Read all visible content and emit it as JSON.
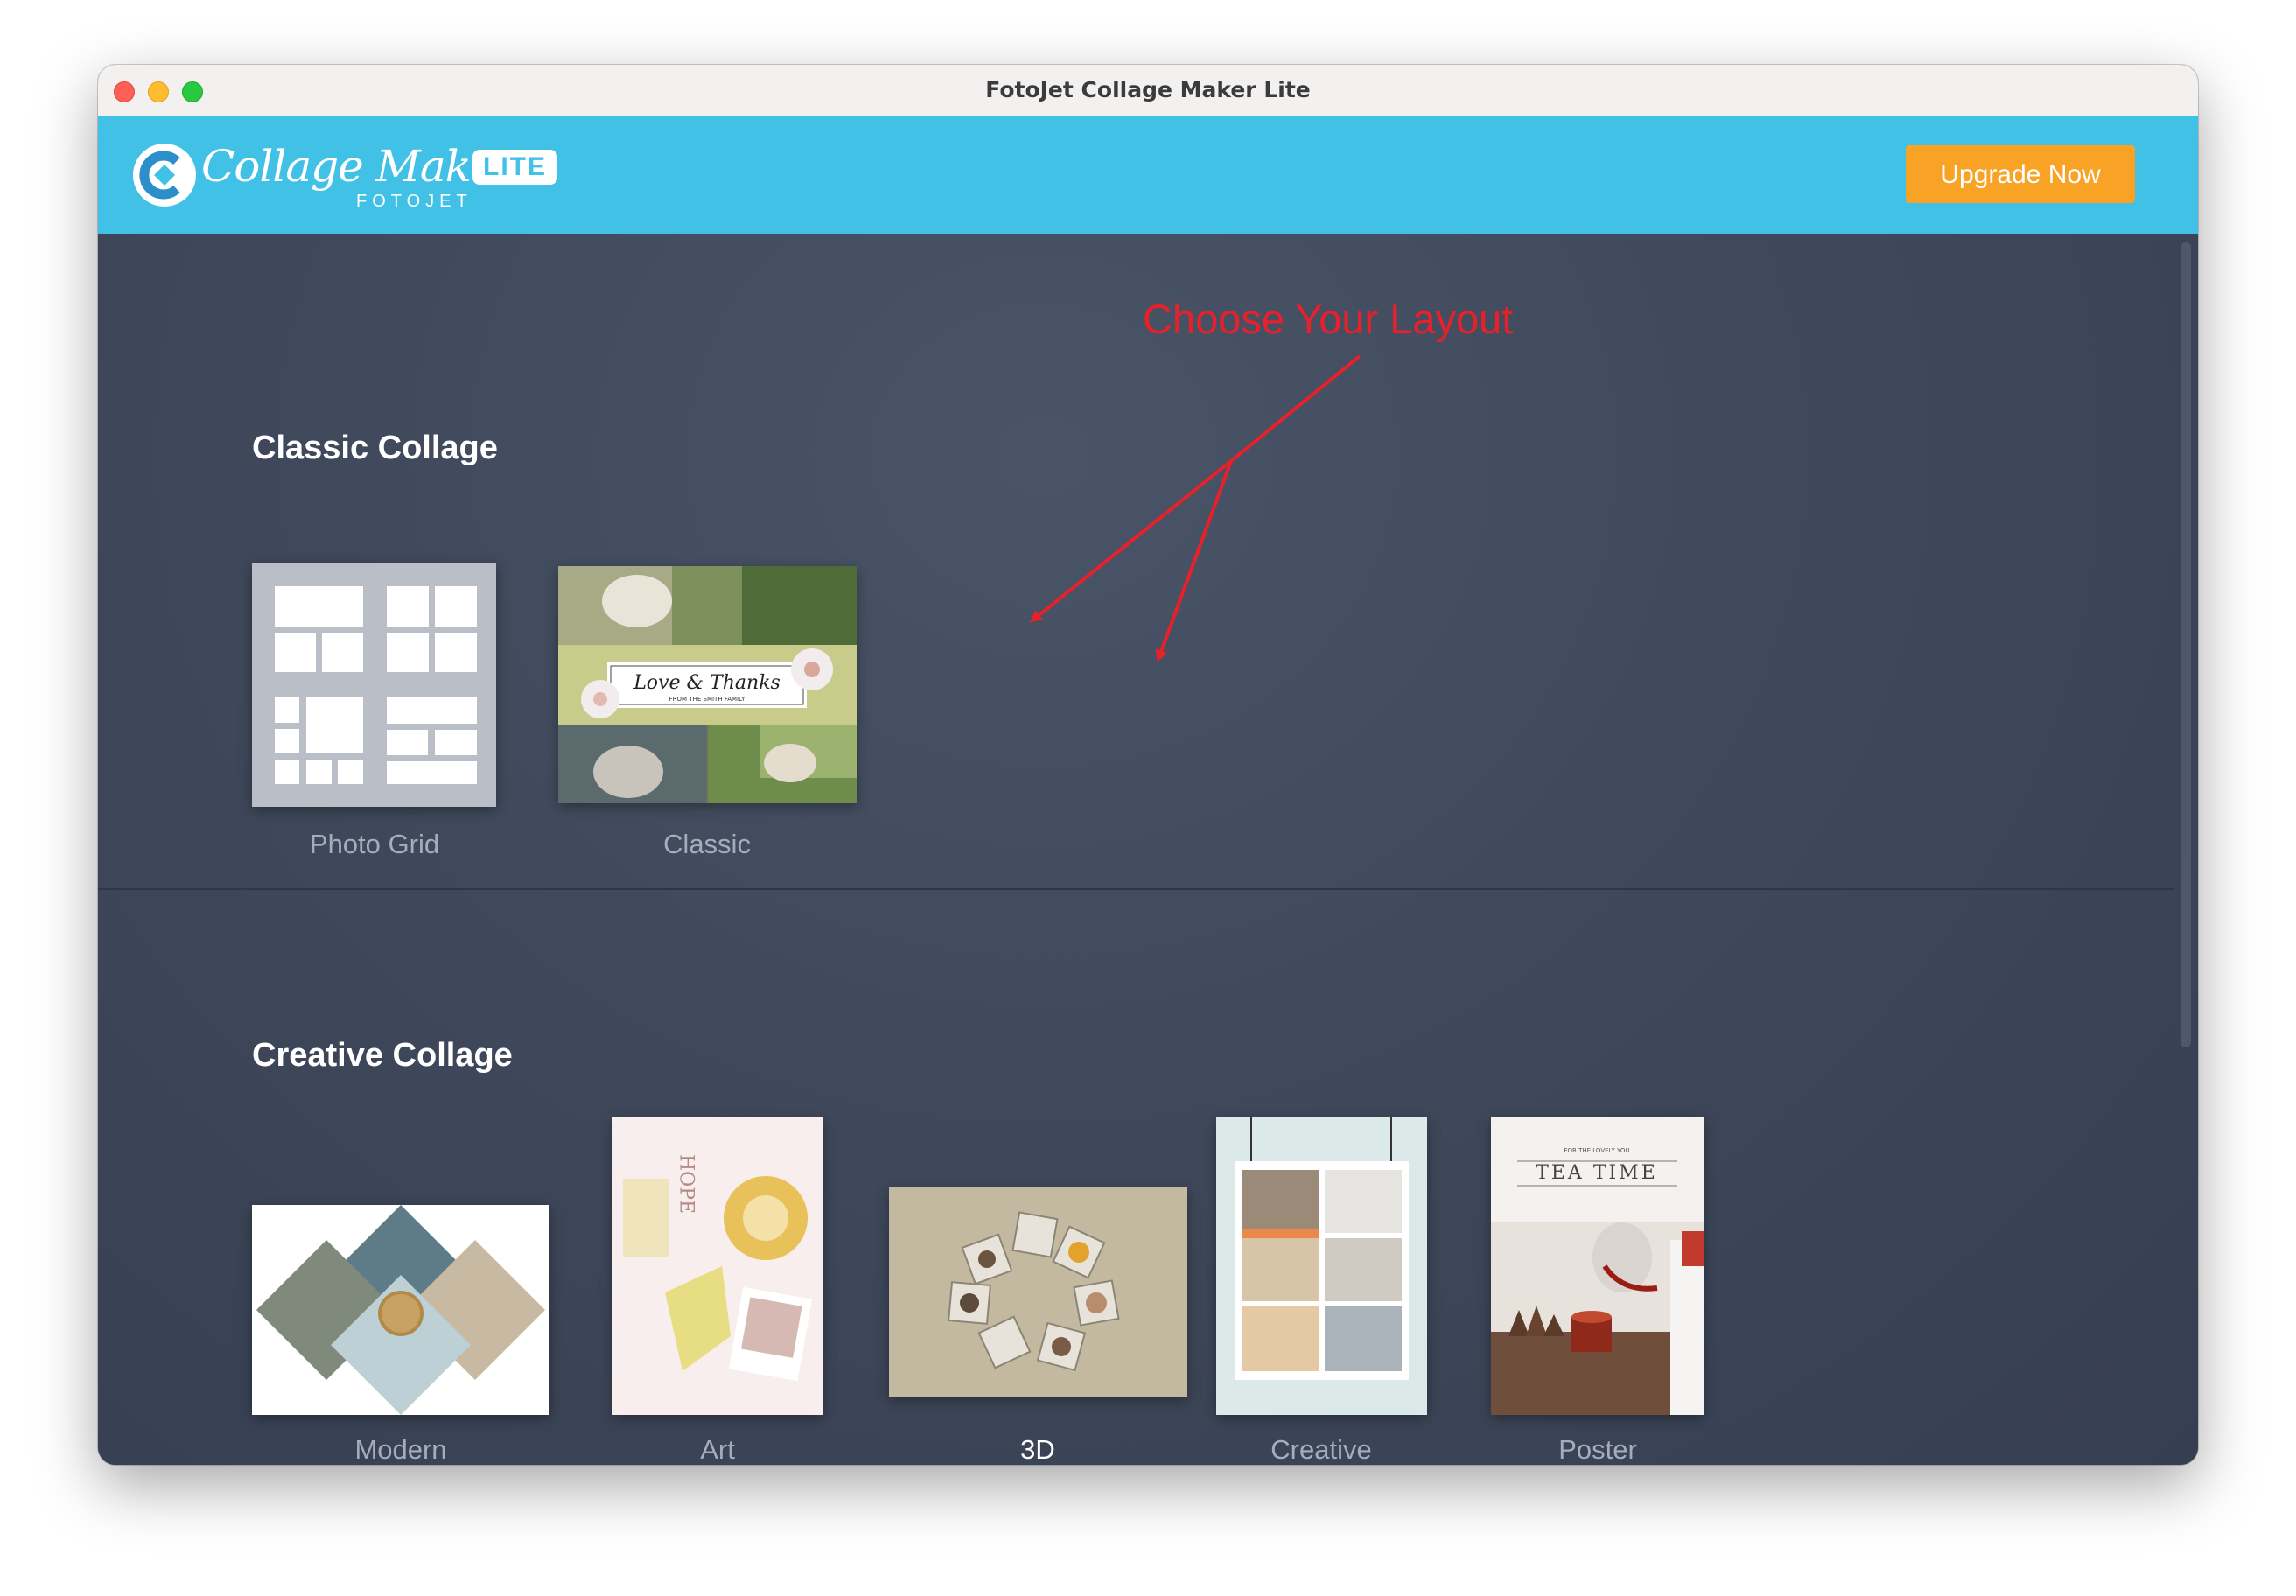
{
  "window": {
    "title": "FotoJet Collage Maker Lite"
  },
  "header": {
    "logo_script": "Collage Maker",
    "logo_sub": "FOTOJET",
    "logo_badge": "LITE",
    "upgrade_label": "Upgrade Now"
  },
  "annotation": {
    "text": "Choose Your Layout"
  },
  "classic": {
    "title": "Classic Collage",
    "items": [
      {
        "label": "Photo Grid"
      },
      {
        "label": "Classic",
        "banner_title": "Love & Thanks",
        "banner_sub": "FROM THE SMITH FAMILY"
      }
    ]
  },
  "creative": {
    "title": "Creative Collage",
    "items": [
      {
        "label": "Modern"
      },
      {
        "label": "Art",
        "word": "HOPE"
      },
      {
        "label": "3D"
      },
      {
        "label": "Creative"
      },
      {
        "label": "Poster",
        "poster_top": "FOR THE LOVELY YOU",
        "poster_title": "TEA TIME"
      }
    ]
  },
  "colors": {
    "header_bg": "#42c1e6",
    "upgrade_bg": "#f9a326",
    "content_bg": "#3c4659",
    "annotation": "#e8202a"
  },
  "icons": [
    "close-icon",
    "minimize-icon",
    "maximize-icon",
    "fotojet-logo-icon"
  ]
}
